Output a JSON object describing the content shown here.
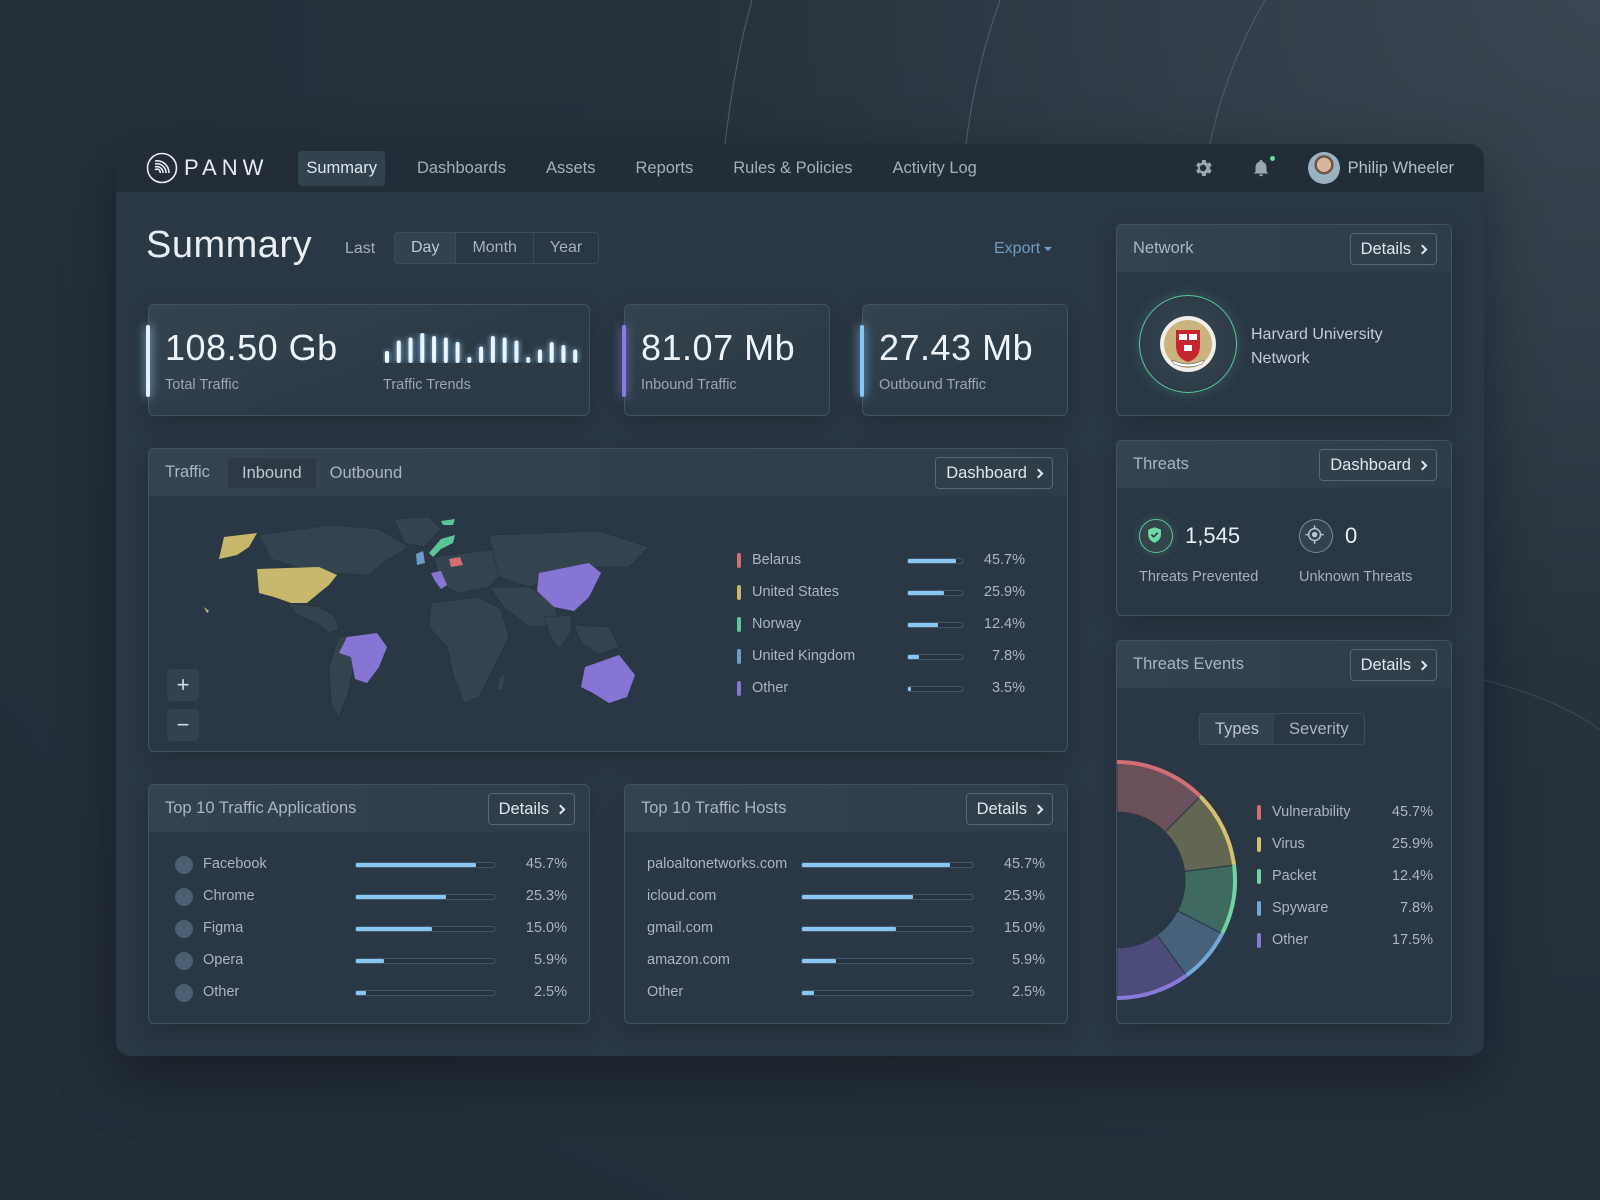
{
  "brand": {
    "name": "PANW"
  },
  "nav": {
    "items": [
      {
        "label": "Summary",
        "active": true
      },
      {
        "label": "Dashboards",
        "active": false
      },
      {
        "label": "Assets",
        "active": false
      },
      {
        "label": "Reports",
        "active": false
      },
      {
        "label": "Rules & Policies",
        "active": false
      },
      {
        "label": "Activity Log",
        "active": false
      }
    ],
    "icons": {
      "settings": "gear-icon",
      "notifications": "bell-icon"
    },
    "user": {
      "name": "Philip Wheeler"
    }
  },
  "header": {
    "title": "Summary",
    "range_label": "Last",
    "range_options": [
      {
        "label": "Day",
        "active": true
      },
      {
        "label": "Month",
        "active": false
      },
      {
        "label": "Year",
        "active": false
      }
    ],
    "export_label": "Export"
  },
  "stats": {
    "total": {
      "value": "108.50 Gb",
      "label": "Total Traffic",
      "trend_label": "Traffic Trends",
      "trend_values": [
        0.4,
        0.75,
        0.85,
        1.0,
        0.9,
        0.85,
        0.7,
        0.2,
        0.55,
        0.9,
        0.85,
        0.75,
        0.2,
        0.45,
        0.7,
        0.6,
        0.45
      ]
    },
    "inbound": {
      "value": "81.07 Mb",
      "label": "Inbound Traffic"
    },
    "outbound": {
      "value": "27.43 Mb",
      "label": "Outbound Traffic"
    }
  },
  "traffic": {
    "title": "Traffic",
    "tabs": [
      {
        "label": "Inbound",
        "active": true
      },
      {
        "label": "Outbound",
        "active": false
      }
    ],
    "button_label": "Dashboard",
    "zoom_in": "+",
    "zoom_out": "−",
    "countries": [
      {
        "name": "Belarus",
        "pct": "45.7%",
        "fill": 0.88,
        "color": "#d16f74"
      },
      {
        "name": "United States",
        "pct": "25.9%",
        "fill": 0.66,
        "color": "#c8b86e"
      },
      {
        "name": "Norway",
        "pct": "12.4%",
        "fill": 0.55,
        "color": "#5bc597"
      },
      {
        "name": "United Kingdom",
        "pct": "7.8%",
        "fill": 0.2,
        "color": "#6b9cc8"
      },
      {
        "name": "Other",
        "pct": "3.5%",
        "fill": 0.06,
        "color": "#8775d6"
      }
    ]
  },
  "apps": {
    "title": "Top 10 Traffic Applications",
    "button_label": "Details",
    "rows": [
      {
        "name": "Facebook",
        "pct": "45.7%",
        "fill": 0.87
      },
      {
        "name": "Chrome",
        "pct": "25.3%",
        "fill": 0.65
      },
      {
        "name": "Figma",
        "pct": "15.0%",
        "fill": 0.55
      },
      {
        "name": "Opera",
        "pct": "5.9%",
        "fill": 0.2
      },
      {
        "name": "Other",
        "pct": "2.5%",
        "fill": 0.07
      }
    ]
  },
  "hosts": {
    "title": "Top 10 Traffic Hosts",
    "button_label": "Details",
    "rows": [
      {
        "name": "paloaltonetworks.com",
        "pct": "45.7%",
        "fill": 0.87
      },
      {
        "name": "icloud.com",
        "pct": "25.3%",
        "fill": 0.65
      },
      {
        "name": "gmail.com",
        "pct": "15.0%",
        "fill": 0.55
      },
      {
        "name": "amazon.com",
        "pct": "5.9%",
        "fill": 0.2
      },
      {
        "name": "Other",
        "pct": "2.5%",
        "fill": 0.07
      }
    ]
  },
  "network": {
    "title": "Network",
    "button_label": "Details",
    "name": "Harvard University Network"
  },
  "threats": {
    "title": "Threats",
    "button_label": "Dashboard",
    "prevented": {
      "value": "1,545",
      "label": "Threats Prevented"
    },
    "unknown": {
      "value": "0",
      "label": "Unknown Threats"
    }
  },
  "threat_events": {
    "title": "Threats Events",
    "button_label": "Details",
    "tabs": [
      {
        "label": "Types",
        "active": true
      },
      {
        "label": "Severity",
        "active": false
      }
    ],
    "segments": [
      {
        "name": "Vulnerability",
        "pct": "45.7%",
        "weight": 0.25,
        "color": "#d16f74",
        "fill": "#6a5059"
      },
      {
        "name": "Virus",
        "pct": "25.9%",
        "weight": 0.21,
        "color": "#d4c073",
        "fill": "#636650"
      },
      {
        "name": "Packet",
        "pct": "12.4%",
        "weight": 0.19,
        "color": "#6fd3a3",
        "fill": "#3f6a60"
      },
      {
        "name": "Spyware",
        "pct": "7.8%",
        "weight": 0.15,
        "color": "#73a9d6",
        "fill": "#46627a"
      },
      {
        "name": "Other",
        "pct": "17.5%",
        "weight": 0.2,
        "color": "#8a78db",
        "fill": "#4c4c7a"
      }
    ]
  }
}
